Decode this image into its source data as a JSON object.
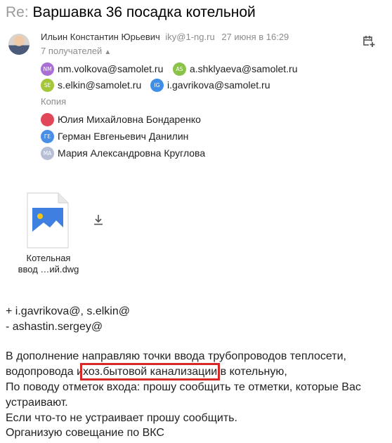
{
  "subject": {
    "prefix": "Re:",
    "title": "Варшавка 36 посадка котельной"
  },
  "sender": {
    "name": "Ильин Константин Юрьевич",
    "email": "iky@1-ng.ru",
    "date": "27 июня в 16:29",
    "recipients_count_label": "7 получателей"
  },
  "icons": {
    "add_to_calendar": "calendar-add-icon",
    "download": "download-icon",
    "attachment": "image-file-icon"
  },
  "recipients": [
    {
      "initials": "NM",
      "email": "nm.volkova@samolet.ru",
      "color": "#a96fd6"
    },
    {
      "initials": "AS",
      "email": "a.shklyaeva@samolet.ru",
      "color": "#8bc34a"
    },
    {
      "initials": "SE",
      "email": "s.elkin@samolet.ru",
      "color": "#a4c639"
    },
    {
      "initials": "IG",
      "email": "i.gavrikova@samolet.ru",
      "color": "#3f8ee8"
    }
  ],
  "copy": {
    "label": "Копия",
    "people": [
      {
        "initials": "",
        "name": "Юлия Михайловна Бондаренко",
        "color": "#e0485a"
      },
      {
        "initials": "ГЕ",
        "name": "Герман Евгеньевич Данилин",
        "color": "#4a8fe7"
      },
      {
        "initials": "МА",
        "name": "Мария Александровна Круглова",
        "color": "#b6bfd6"
      }
    ]
  },
  "attachment": {
    "name_line1": "Котельная",
    "name_line2": "ввод …ий.dwg"
  },
  "body": {
    "line1": "+ i.gavrikova@, s.elkin@",
    "line2": "- ashastin.sergey@",
    "p1_line1": "В дополнение направляю точки ввода трубопроводов теплосети,",
    "p1_line2_pre": "водопровода и",
    "p1_line2_highlight": "хоз.бытовой канализации",
    "p1_line2_post": "в котельную,",
    "p2_line1": "По поводу отметок входа: прошу сообщить те отметки, которые Вас",
    "p2_line2": "устраивают.",
    "p3": "Если что-то не устраивает прошу сообщить.",
    "p4": "Организую совещание по ВКС"
  }
}
